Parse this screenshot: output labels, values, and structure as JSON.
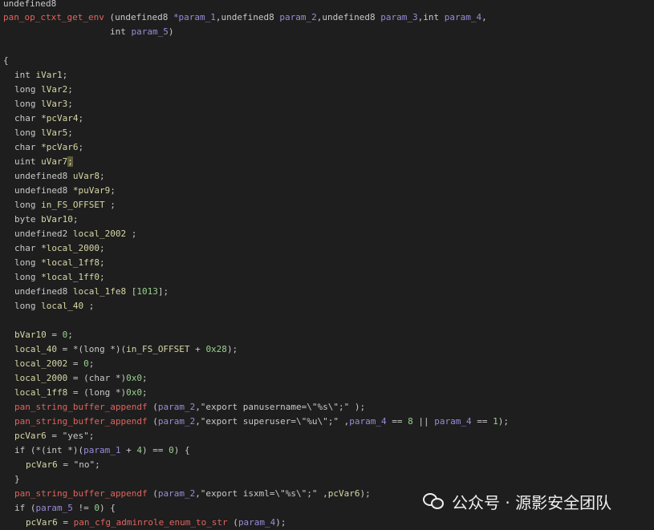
{
  "lines": {
    "l01": "undefined8",
    "l02_fn": "pan_op_ctxt_get_env",
    "l02_a": " (undefined8 ",
    "l02_p1": "*param_1",
    "l02_b": ",undefined8 ",
    "l02_p2": "param_2",
    "l02_c": ",undefined8 ",
    "l02_p3": "param_3",
    "l02_d": ",int ",
    "l02_p4": "param_4",
    "l02_e": ",",
    "l03_a": "int ",
    "l03_p5": "param_5",
    "l03_b": ")",
    "l05": "{",
    "d01_t": "int ",
    "d01_v": "iVar1",
    "d01_e": ";",
    "d02_t": "long ",
    "d02_v": "lVar2",
    "d02_e": ";",
    "d03_t": "long ",
    "d03_v": "lVar3",
    "d03_e": ";",
    "d04_t": "char ",
    "d04_v": "*pcVar4",
    "d04_e": ";",
    "d05_t": "long ",
    "d05_v": "lVar5",
    "d05_e": ";",
    "d06_t": "char ",
    "d06_v": "*pcVar6",
    "d06_e": ";",
    "d07_t": "uint ",
    "d07_v": "uVar7",
    "d07_e": ";",
    "d08_t": "undefined8 ",
    "d08_v": "uVar8",
    "d08_e": ";",
    "d09_t": "undefined8 ",
    "d09_v": "*puVar9",
    "d09_e": ";",
    "d10_t": "long ",
    "d10_v": "in_FS_OFFSET",
    "d10_e": " ;",
    "d11_t": "byte ",
    "d11_v": "bVar10",
    "d11_e": ";",
    "d12_t": "undefined2 ",
    "d12_v": "local_2002",
    "d12_e": " ;",
    "d13_t": "char ",
    "d13_v": "*local_2000",
    "d13_e": ";",
    "d14_t": "long ",
    "d14_v": "*local_1ff8",
    "d14_e": ";",
    "d15_t": "long ",
    "d15_v": "*local_1ff0",
    "d15_e": ";",
    "d16_t": "undefined8 ",
    "d16_v": "local_1fe8",
    "d16_m": " [",
    "d16_n": "1013",
    "d16_e": "];",
    "d17_t": "long ",
    "d17_v": "local_40",
    "d17_e": " ;",
    "s01_v": "bVar10",
    "s01_a": " = ",
    "s01_n": "0",
    "s01_e": ";",
    "s02_v": "local_40",
    "s02_a": " = *(long *)(",
    "s02_v2": "in_FS_OFFSET",
    "s02_b": " + ",
    "s02_n": "0x28",
    "s02_e": ");",
    "s03_v": "local_2002",
    "s03_a": " = ",
    "s03_n": "0",
    "s03_e": ";",
    "s04_v": "local_2000",
    "s04_a": " = (char *)",
    "s04_n": "0x0",
    "s04_e": ";",
    "s05_v": "local_1ff8",
    "s05_a": " = (long *)",
    "s05_n": "0x0",
    "s05_e": ";",
    "s06_f": "pan_string_buffer_appendf",
    "s06_a": " (",
    "s06_p": "param_2",
    "s06_s": ",\"export panusername=\\\"%s\\\";\"",
    "s06_e": " );",
    "s07_f": "pan_string_buffer_appendf",
    "s07_a": " (",
    "s07_p": "param_2",
    "s07_s": ",\"export superuser=\\\"%u\\\";\"",
    "s07_b": " ,",
    "s07_p4": "param_4",
    "s07_c": " == ",
    "s07_n1": "8",
    "s07_d": " || ",
    "s07_p4b": "param_4",
    "s07_g": " == ",
    "s07_n2": "1",
    "s07_e": ");",
    "s08_v": "pcVar6",
    "s08_a": " = ",
    "s08_s": "\"yes\"",
    "s08_e": ";",
    "s09_a": "if (*(int *)(",
    "s09_p": "param_1",
    "s09_b": " + ",
    "s09_n1": "4",
    "s09_c": ") == ",
    "s09_n2": "0",
    "s09_e": ") {",
    "s10_v": "pcVar6",
    "s10_a": " = ",
    "s10_s": "\"no\"",
    "s10_e": ";",
    "s11": "}",
    "s12_f": "pan_string_buffer_appendf",
    "s12_a": " (",
    "s12_p": "param_2",
    "s12_s": ",\"export isxml=\\\"%s\\\";\"",
    "s12_b": " ,",
    "s12_v": "pcVar6",
    "s12_e": ");",
    "s13_a": "if (",
    "s13_p": "param_5",
    "s13_b": " != ",
    "s13_n": "0",
    "s13_e": ") {",
    "s14_v": "pcVar6",
    "s14_a": " = ",
    "s14_f": "pan_cfg_adminrole_enum_to_str",
    "s14_b": " (",
    "s14_p": "param_4",
    "s14_e": ");"
  },
  "watermark": {
    "icon": "wechat-icon",
    "text": "公众号 · 源影安全团队"
  },
  "colors": {
    "background": "#1e1e1e",
    "variable": "#d6d7a6",
    "parameter": "#9b8bd8",
    "function": "#e0645d",
    "number": "#97d38d"
  }
}
